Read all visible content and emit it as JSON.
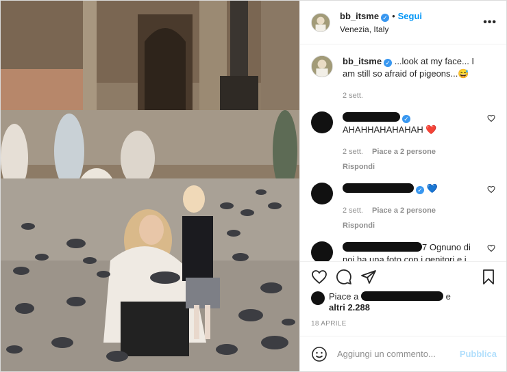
{
  "post": {
    "username": "bb_itsme",
    "follow_label": "Segui",
    "location": "Venezia, Italy",
    "more_label": "•••"
  },
  "caption": {
    "username": "bb_itsme",
    "text": "...look at my face... I am still so afraid of pigeons...😅",
    "time": "2 sett."
  },
  "comments": [
    {
      "text": "AHAHHAHAHAHAH ❤️",
      "time": "2 sett.",
      "likes": "Piace a 2 persone",
      "reply": "Rispondi"
    },
    {
      "text": "💙",
      "time": "2 sett.",
      "likes": "Piace a 2 persone",
      "reply": "Rispondi"
    },
    {
      "text_prefix": "7",
      "text": "Ognuno di noi ha una foto con i genitori e i piccioni 😍"
    }
  ],
  "likes": {
    "prefix": "Piace a",
    "suffix": "e",
    "others": "altri 2.288"
  },
  "date": "18 APRILE",
  "add_comment": {
    "placeholder": "Aggiungi un commento...",
    "publish_label": "Pubblica"
  }
}
